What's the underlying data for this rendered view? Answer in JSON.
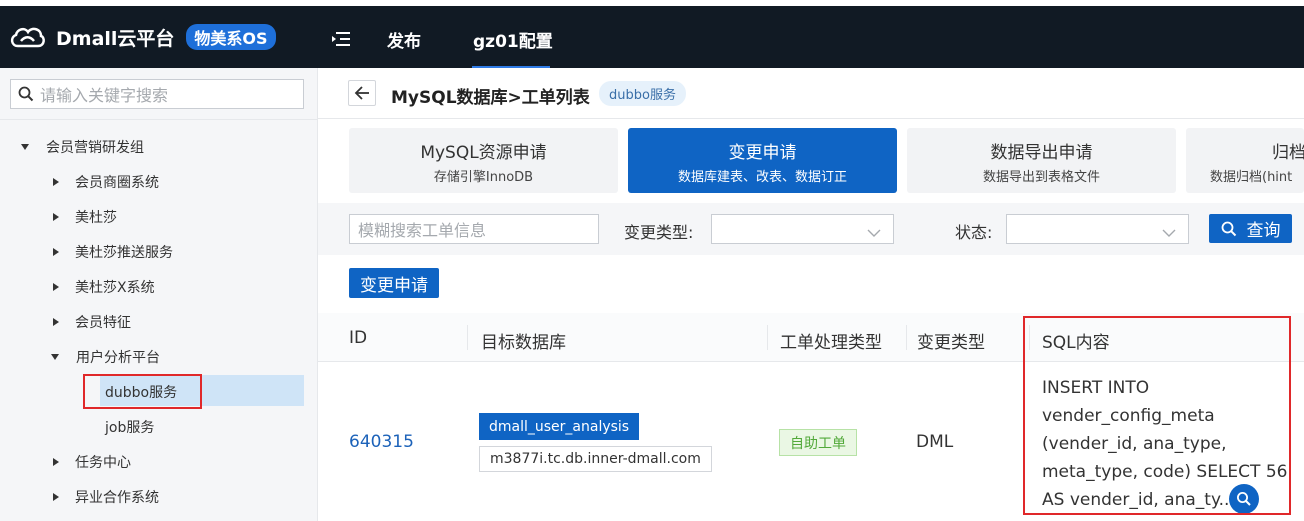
{
  "topbar": {
    "brand_name": "Dmall云平台",
    "brand_badge": "物美系OS",
    "nav": [
      "发布",
      "gz01配置"
    ]
  },
  "sidebar": {
    "search_placeholder": "请输入关键字搜索",
    "tree": [
      {
        "label": "会员营销研发组",
        "state": "expanded"
      },
      {
        "label": "会员商圈系统",
        "state": "collapsed"
      },
      {
        "label": "美杜莎",
        "state": "collapsed"
      },
      {
        "label": "美杜莎推送服务",
        "state": "collapsed"
      },
      {
        "label": "美杜莎X系统",
        "state": "collapsed"
      },
      {
        "label": "会员特征",
        "state": "collapsed"
      },
      {
        "label": "用户分析平台",
        "state": "expanded"
      },
      {
        "label": "dubbo服务",
        "state": "selected"
      },
      {
        "label": "job服务",
        "state": "leaf"
      },
      {
        "label": "任务中心",
        "state": "collapsed"
      },
      {
        "label": "异业合作系统",
        "state": "collapsed"
      }
    ]
  },
  "header": {
    "title": "MySQL数据库>工单列表",
    "tag": "dubbo服务"
  },
  "cards": [
    {
      "title": "MySQL资源申请",
      "sub": "存储引擎InnoDB"
    },
    {
      "title": "变更申请",
      "sub": "数据库建表、改表、数据订正"
    },
    {
      "title": "数据导出申请",
      "sub": "数据导出到表格文件"
    },
    {
      "title": "归档",
      "sub": "数据归档(hint"
    }
  ],
  "filters": {
    "search_placeholder": "模糊搜索工单信息",
    "change_type_label": "变更类型:",
    "status_label": "状态:",
    "query_label": "查询"
  },
  "apply_button": "变更申请",
  "table": {
    "headers": [
      "ID",
      "目标数据库",
      "工单处理类型",
      "变更类型",
      "SQL内容"
    ],
    "rows": [
      {
        "id": "640315",
        "db": "dmall_user_analysis",
        "host": "m3877i.tc.db.inner-dmall.com",
        "process_type": "自助工单",
        "change_type": "DML",
        "sql_lines": [
          "INSERT INTO",
          "vender_config_meta",
          "(vender_id, ana_type,",
          "meta_type, code) SELECT 56",
          "AS vender_id, ana_ty..."
        ]
      }
    ]
  },
  "colors": {
    "topbar_bg": "#111a24",
    "primary": "#0f64c4",
    "highlight": "#e0282a",
    "selected_bg": "#cfe4f7"
  }
}
